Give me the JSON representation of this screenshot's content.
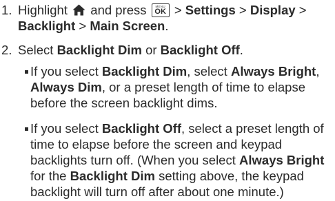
{
  "steps": [
    {
      "number": "1.",
      "part_a": "Highlight",
      "part_b": "and press",
      "path": [
        "Settings",
        "Display",
        "Backlight",
        "Main Screen"
      ],
      "separator": ">",
      "end": "."
    },
    {
      "number": "2.",
      "prefix": "Select",
      "option_a": "Backlight Dim",
      "connector": "or",
      "option_b": "Backlight Off",
      "end": "."
    }
  ],
  "bullets": [
    {
      "intro": "If you select",
      "term": "Backlight Dim",
      "mid": ", select",
      "opt1": "Always Bright",
      "comma": ",",
      "opt2": "Always Dim",
      "rest": ", or a preset length of time to elapse before the screen backlight dims."
    },
    {
      "intro": "If you select",
      "term": "Backlight Off",
      "rest1": ", select a preset length of time to elapse before the screen and keypad backlights turn off. (When you select",
      "opt1": "Always Bright",
      "rest2": "for the",
      "term2": "Backlight Dim",
      "rest3": "setting above, the keypad backlight will turn off after about one minute.)"
    }
  ],
  "icons": {
    "home": "home-icon",
    "menu_ok": "menu-ok-key-icon",
    "menu_key_top": "MENU",
    "menu_key_bottom": "OK"
  }
}
